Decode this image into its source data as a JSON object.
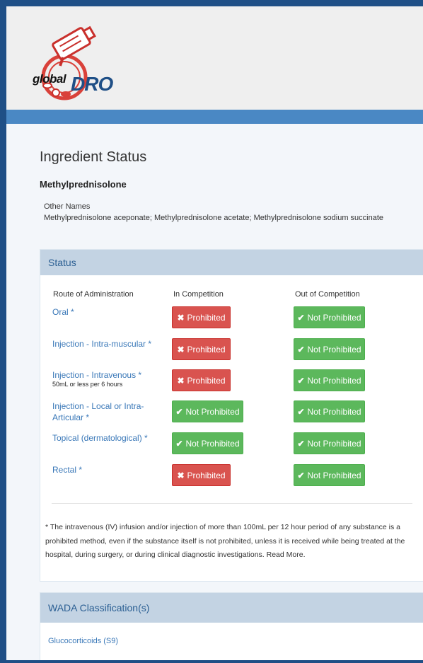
{
  "logo": {
    "word_global": "global",
    "word_dro": "DRO",
    "icon": "camera-pills-logo-icon"
  },
  "page": {
    "title": "Ingredient Status",
    "ingredient": "Methylprednisolone",
    "other_names_label": "Other Names",
    "other_names_value": "Methylprednisolone aceponate; Methylprednisolone acetate; Methylprednisolone sodium succinate"
  },
  "status": {
    "heading": "Status",
    "columns": [
      "Route of Administration",
      "In Competition",
      "Out of Competition"
    ],
    "rows": [
      {
        "route": "Oral  *",
        "note": "",
        "in": "Prohibited",
        "out": "Not Prohibited"
      },
      {
        "route": "Injection - Intra-muscular  *",
        "note": "",
        "in": "Prohibited",
        "out": "Not Prohibited"
      },
      {
        "route": "Injection - Intravenous  *",
        "note": "50mL or less per 6 hours",
        "in": "Prohibited",
        "out": "Not Prohibited"
      },
      {
        "route": "Injection - Local or Intra-Articular *",
        "note": "",
        "in": "Not Prohibited",
        "out": "Not Prohibited"
      },
      {
        "route": "Topical (dermatological)  *",
        "note": "",
        "in": "Not Prohibited",
        "out": "Not Prohibited"
      },
      {
        "route": "Rectal  *",
        "note": "",
        "in": "Prohibited",
        "out": "Not Prohibited"
      }
    ],
    "footnote": "* The intravenous (IV) infusion and/or injection of more than 100mL per 12 hour period of any substance is a prohibited method, even if the substance itself is not prohibited, unless it is received while being treated at the hospital, during surgery, or during clinical diagnostic investigations. Read More."
  },
  "wada": {
    "heading": "WADA Classification(s)",
    "item": "Glucocorticoids (S9)"
  },
  "colors": {
    "frame_border": "#1f4f86",
    "header_bar": "#4a88c4",
    "panel_head": "#c3d3e3",
    "prohibited": "#d9534f",
    "not_prohibited": "#5cb85c",
    "link": "#3a78b8"
  }
}
